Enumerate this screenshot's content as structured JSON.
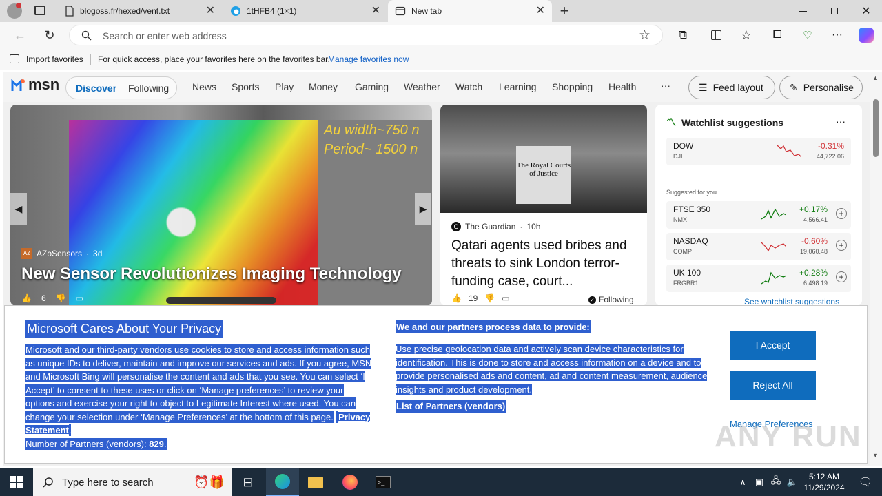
{
  "browser": {
    "tabs": [
      {
        "title": "blogoss.fr/hexed/vent.txt",
        "icon": "page-icon"
      },
      {
        "title": "1tHFB4 (1×1)",
        "icon": "edge-icon"
      },
      {
        "title": "New tab",
        "icon": "newtab-icon"
      }
    ],
    "address_placeholder": "Search or enter web address",
    "favorites": {
      "import_label": "Import favorites",
      "message": "For quick access, place your favorites here on the favorites bar.",
      "manage_link": "Manage favorites now"
    }
  },
  "msn": {
    "logo": "msn",
    "segmented": [
      "Discover",
      "Following"
    ],
    "nav": [
      "News",
      "Sports",
      "Play",
      "Money",
      "Gaming",
      "Weather",
      "Watch",
      "Learning",
      "Shopping",
      "Health"
    ],
    "more": "···",
    "feed_layout": "Feed layout",
    "personalise": "Personalise",
    "hero": {
      "source": "AZoSensors",
      "age": "3d",
      "title": "New Sensor Revolutionizes Imaging Technology",
      "likes": "6",
      "image_text_1": "Au width~750 n",
      "image_text_2": "Period~ 1500 n"
    },
    "story": {
      "source": "The Guardian",
      "age": "10h",
      "title": "Qatari agents used bribes and threats to sink London terror-funding case, court...",
      "likes": "19",
      "following": "Following",
      "image_text": "The Royal Courts of Justice"
    },
    "watchlist": {
      "title": "Watchlist suggestions",
      "main": {
        "name": "DOW",
        "ticker": "DJI",
        "change": "-0.31%",
        "value": "44,722.06"
      },
      "suggested_label": "Suggested for you",
      "items": [
        {
          "name": "FTSE 350",
          "ticker": "NMX",
          "change": "+0.17%",
          "value": "4,566.41",
          "up": true
        },
        {
          "name": "NASDAQ",
          "ticker": "COMP",
          "change": "-0.60%",
          "value": "19,060.48",
          "up": false
        },
        {
          "name": "UK 100",
          "ticker": "FRGBR1",
          "change": "+0.28%",
          "value": "6,498.19",
          "up": true
        }
      ],
      "see_more": "See watchlist suggestions"
    }
  },
  "consent": {
    "title": "Microsoft Cares About Your Privacy",
    "body": "Microsoft and our third-party vendors use cookies to store and access information such as unique IDs to deliver, maintain and improve our services and ads. If you agree, MSN and Microsoft Bing will personalise the content and ads that you see. You can select ‘I Accept’ to consent to these uses or click on ‘Manage preferences’ to review your options and exercise your right to object to Legitimate Interest where used.  You can change your selection under ‘Manage Preferences’ at the bottom of this page.",
    "privacy_link": "Privacy Statement",
    "partners_label": "Number of Partners (vendors):",
    "partners_count": "829",
    "right_title": "We and our partners process data to provide:",
    "right_body": "Use precise geolocation data and actively scan device characteristics for identification. This is done to store and access information on a device and to provide personalised ads and content, ad and content measurement, audience insights and product development.",
    "list_link": "List of Partners (vendors)",
    "accept": "I Accept",
    "reject": "Reject All",
    "manage": "Manage Preferences",
    "watermark": "ANY RUN"
  },
  "taskbar": {
    "search_placeholder": "Type here to search",
    "time": "5:12 AM",
    "date": "11/29/2024"
  },
  "colors": {
    "accent": "#0f6cbd",
    "selection": "#2f5fcf",
    "taskbar": "#1c2b3a",
    "positive": "#107c10",
    "negative": "#d13438"
  }
}
